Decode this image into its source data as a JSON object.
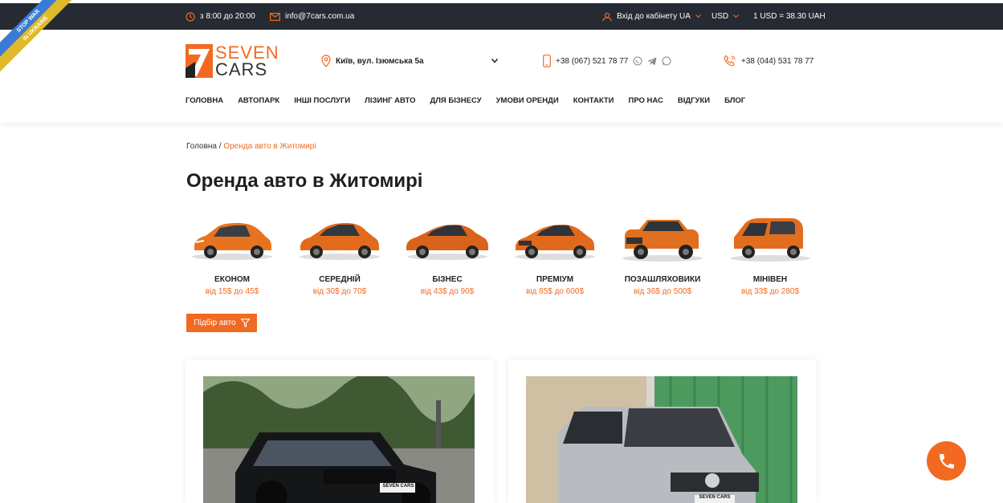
{
  "ribbon": {
    "line1": "STOP WAR",
    "line2": "IN UKRAINE"
  },
  "topbar": {
    "hours": "з 8:00 до 20:00",
    "email": "info@7cars.com.ua",
    "login": "Вхід до кабінету",
    "language": "UA",
    "currency": "USD",
    "rate": "1 USD = 38.30 UAH"
  },
  "header": {
    "logo_top": "SEVEN",
    "logo_bottom": "CARS",
    "logo_mark": "7",
    "location": "Київ, вул. Ізюмська 5а",
    "phone_mobile": "+38 (067) 521 78 77",
    "phone_landline": "+38 (044) 531 78 77"
  },
  "nav": [
    "ГОЛОВНА",
    "АВТОПАРК",
    "ІНШІ ПОСЛУГИ",
    "ЛІЗИНГ АВТО",
    "ДЛЯ БІЗНЕСУ",
    "УМОВИ ОРЕНДИ",
    "КОНТАКТИ",
    "ПРО НАС",
    "ВІДГУКИ",
    "БЛОГ"
  ],
  "breadcrumb": {
    "home": "Головна",
    "separator": " / ",
    "current": "Оренда авто в Житомирі"
  },
  "page": {
    "title": "Оренда авто в Житомирі"
  },
  "categories": [
    {
      "name": "ЕКОНОМ",
      "price": "від 15$ до 45$"
    },
    {
      "name": "СЕРЕДНІЙ",
      "price": "від 30$ до 70$"
    },
    {
      "name": "БІЗНЕС",
      "price": "від 43$ до 90$"
    },
    {
      "name": "ПРЕМІУМ",
      "price": "від 85$ до 600$"
    },
    {
      "name": "ПОЗАШЛЯХОВИКИ",
      "price": "від 36$ до 500$"
    },
    {
      "name": "МІНІВЕН",
      "price": "від 33$ до 280$"
    }
  ],
  "filter": {
    "label": "Підбір авто"
  },
  "cards": [
    {
      "plate": "SEVEN CARS"
    },
    {
      "plate": "SEVEN CARS"
    }
  ],
  "colors": {
    "accent": "#f26a21",
    "topbar": "#262a33"
  }
}
